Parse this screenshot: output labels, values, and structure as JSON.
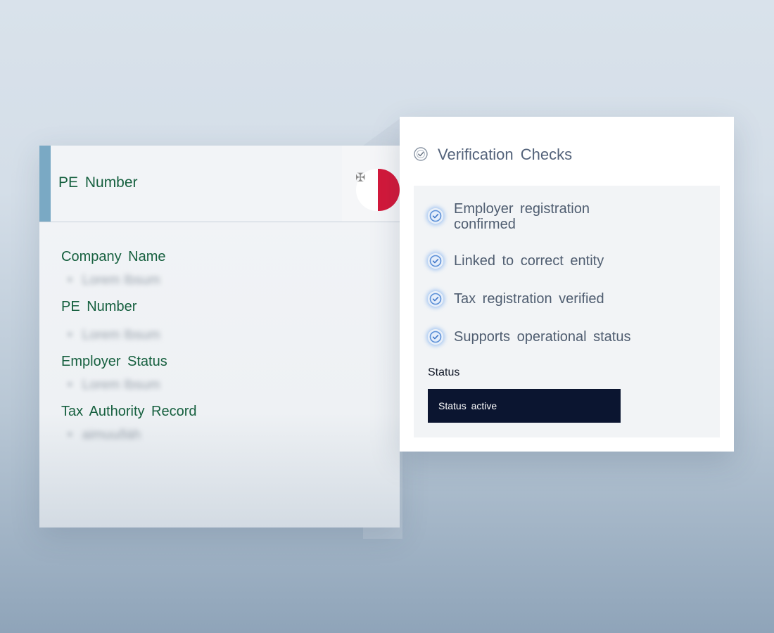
{
  "left_panel": {
    "header_title": "PE Number",
    "fields": [
      {
        "label": "Company Name",
        "value": "Lorem Ibsum"
      },
      {
        "label": "PE Number",
        "value": "Lorem Ibsum"
      },
      {
        "label": "Employer Status",
        "value": "Lorem Ibsum"
      },
      {
        "label": "Tax Authority Record",
        "value": "aimuuðàh"
      }
    ]
  },
  "right_panel": {
    "title": "Verification Checks",
    "checks": [
      "Employer registration confirmed",
      "Linked to correct entity",
      "Tax registration verified",
      "Supports operational status"
    ],
    "status_label": "Status",
    "status_value": "Status active"
  },
  "colors": {
    "accent": "#7aa9c4",
    "label_green": "#16603f",
    "flag_red": "#d3183a",
    "status_bg": "#0b1530",
    "check_blue": "#5b8fd6"
  },
  "icons": [
    "shield-check-icon",
    "check-circle-icon",
    "flag-icon"
  ]
}
